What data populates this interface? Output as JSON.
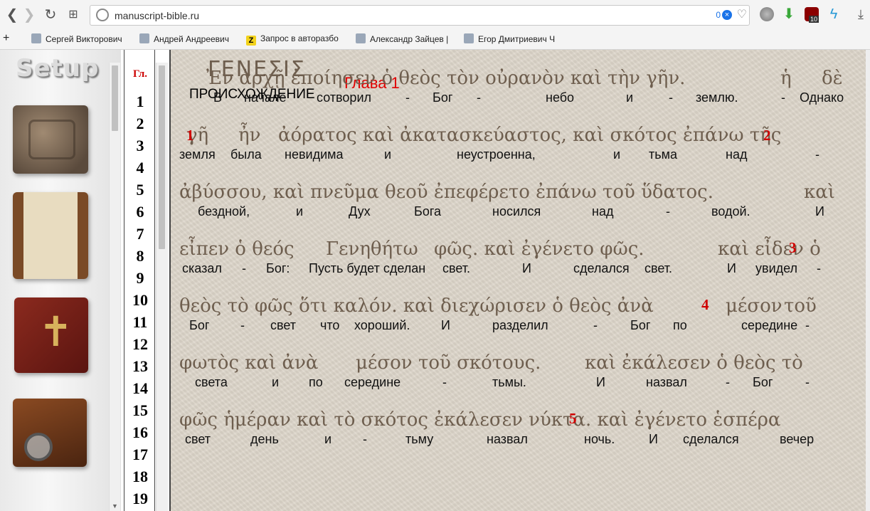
{
  "browser": {
    "url": "manuscript-bible.ru",
    "counter": "0",
    "bookmarks": [
      "Сергей Викторович",
      "Андрей Андреевич",
      "Запрос в авторазбо",
      "Александр Зайцев |",
      "Егор Дмитриевич Ч"
    ],
    "ext_badge": "10"
  },
  "sidebar": {
    "title": "Setup"
  },
  "chapters": {
    "header": "Гл.",
    "numbers": [
      "1",
      "2",
      "3",
      "4",
      "5",
      "6",
      "7",
      "8",
      "9",
      "10",
      "11",
      "12",
      "13",
      "14",
      "15",
      "16",
      "17",
      "18",
      "19"
    ]
  },
  "text": {
    "book_greek": "ΓΕΝΕΣΙΣ",
    "book_russian": "ПРОИСХОЖДЕНИЕ",
    "chapter_label": "Глава 1",
    "verse_numbers": [
      "1",
      "2",
      "3",
      "4",
      "5"
    ],
    "lines": [
      {
        "greek": [
          "Ἐν ἀρχῇ ἐποίησεν ὁ θεὸς τὸν οὐρανὸν καὶ τὴν γῆν.",
          "ἡ",
          "δὲ"
        ],
        "russian": [
          "В",
          "начале",
          "сотворил",
          "-",
          "Бог",
          "-",
          "небо",
          "и",
          "-",
          "землю.",
          "-",
          "Однако"
        ]
      },
      {
        "greek": [
          "γῆ",
          "ἦν",
          "ἀόρατος καὶ ἀκατασκεύαστος, καὶ σκότος ἐπάνω τῆς"
        ],
        "russian": [
          "земля",
          "была",
          "невидима",
          "и",
          "неустроенна,",
          "и",
          "тьма",
          "над",
          "-"
        ]
      },
      {
        "greek": [
          "ἀβύσσου, καὶ πνεῦμα θεοῦ ἐπεφέρετο ἐπάνω τοῦ ὕδατος.",
          "καὶ"
        ],
        "russian": [
          "бездной,",
          "и",
          "Дух",
          "Бога",
          "носился",
          "над",
          "-",
          "водой.",
          "И"
        ]
      },
      {
        "greek": [
          "εἶπεν ὁ θεός",
          "Γενηθήτω",
          "φῶς. καὶ ἐγένετο φῶς.",
          "καὶ εἶδεν ὁ"
        ],
        "russian": [
          "сказал",
          "-",
          "Бог:",
          "Пусть будет сделан",
          "свет.",
          "И",
          "сделался",
          "свет.",
          "И",
          "увидел",
          "-"
        ]
      },
      {
        "greek": [
          "θεὸς τὸ φῶς ὅτι καλόν. καὶ διεχώρισεν ὁ θεὸς ἀνὰ",
          "μέσον",
          "τοῦ"
        ],
        "russian": [
          "Бог",
          "-",
          "свет",
          "что",
          "хороший.",
          "И",
          "разделил",
          "-",
          "Бог",
          "по",
          "середине",
          "-"
        ]
      },
      {
        "greek": [
          "φωτὸς καὶ ἀνὰ",
          "μέσον",
          "τοῦ σκότους.",
          "καὶ ἐκάλεσεν ὁ θεὸς τὸ"
        ],
        "russian": [
          "света",
          "и",
          "по",
          "середине",
          "-",
          "тьмы.",
          "И",
          "назвал",
          "-",
          "Бог",
          "-"
        ]
      },
      {
        "greek": [
          "φῶς ἡμέραν καὶ τὸ σκότος ἐκάλεσεν νύκτα. καὶ ἐγένετο ἑσπέρα"
        ],
        "russian": [
          "свет",
          "день",
          "и",
          "-",
          "тьму",
          "назвал",
          "ночь.",
          "И",
          "сделался",
          "вечер"
        ]
      }
    ]
  }
}
